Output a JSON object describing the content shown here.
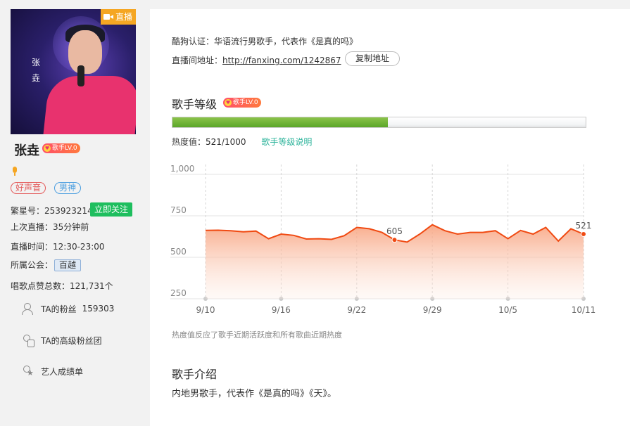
{
  "profile": {
    "avatar_caption": "张\n垚",
    "live_label": "直播",
    "name": "张垚",
    "level_badge": "歌手LV.0",
    "tags": [
      "好声音",
      "男神"
    ],
    "id_label": "繁星号：",
    "id_value": "253923214",
    "follow_label": "立即关注",
    "last_live_label": "上次直播：",
    "last_live_value": "35分钟前",
    "live_time_label": "直播时间：",
    "live_time_value": "12:30-23:00",
    "guild_label": "所属公会：",
    "guild_value": "百越",
    "likes_label": "唱歌点赞总数：",
    "likes_value": "121,731个"
  },
  "side_links": [
    {
      "label": "TA的粉丝",
      "count": "159303",
      "icon": "fans-icon"
    },
    {
      "label": "TA的高级粉丝团",
      "count": "",
      "icon": "fan-club-icon"
    },
    {
      "label": "艺人成绩单",
      "count": "",
      "icon": "rank-icon"
    }
  ],
  "main": {
    "cert_label": "酷狗认证：",
    "cert_value": "华语流行男歌手，代表作《是真的吗》",
    "room_label": "直播间地址：",
    "room_url": "http://fanxing.com/1242867",
    "copy_label": "复制地址",
    "level_title": "歌手等级",
    "level_badge": "歌手LV.0",
    "heat_label": "热度值：",
    "heat_value": "521",
    "heat_max": "/1000",
    "heat_progress": 0.521,
    "explain_label": "歌手等级说明",
    "note": "热度值反应了歌手近期活跃度和所有歌曲近期热度",
    "intro_title": "歌手介绍",
    "intro_text": "内地男歌手，代表作《是真的吗》《天》。"
  },
  "colors": {
    "accent_orange": "#f5a623",
    "line": "#f04a12",
    "follow_green": "#1ebe5e",
    "progress_green": "#6db33f",
    "explain_teal": "#2bb39a"
  },
  "chart_data": {
    "type": "area",
    "xlabel": "",
    "ylabel": "",
    "ylim": [
      250,
      1000
    ],
    "yticks": [
      "1,000",
      "750",
      "500",
      "250"
    ],
    "ytick_values": [
      1000,
      750,
      500,
      250
    ],
    "xticks": [
      "9/10",
      "9/16",
      "9/22",
      "9/29",
      "10/5",
      "10/11"
    ],
    "grid": true,
    "series": [
      {
        "values": [
          662,
          663,
          660,
          654,
          658,
          612,
          640,
          632,
          610,
          612,
          608,
          630,
          680,
          672,
          650,
          605,
          592,
          640,
          696,
          660,
          640,
          650,
          650,
          660,
          612,
          662,
          640,
          680,
          598,
          672,
          640
        ]
      }
    ],
    "annotations": [
      {
        "index": 15,
        "label": "605",
        "y": 705
      },
      {
        "index": 30,
        "label": "521",
        "y": 640
      }
    ]
  }
}
